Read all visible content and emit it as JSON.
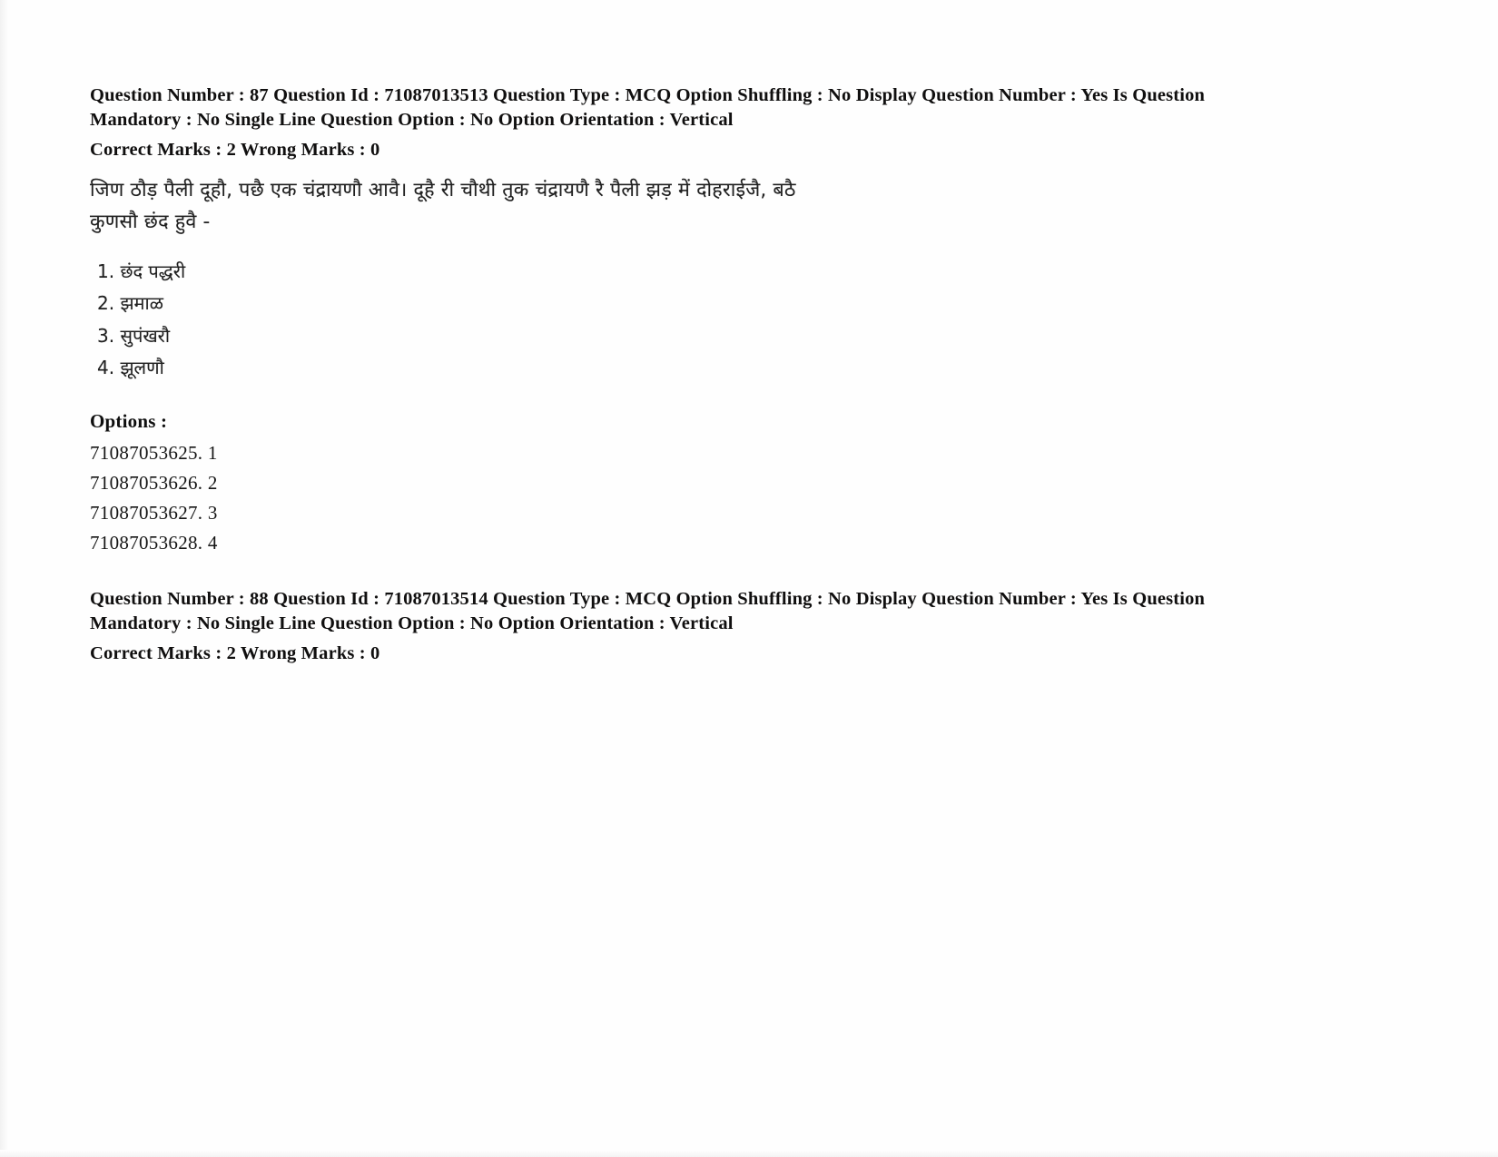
{
  "document": {
    "kind": "exam-question-dump",
    "page_background": "#ffffff",
    "text_color": "#111111"
  },
  "questions": [
    {
      "meta_line_1": "Question Number : 87 Question Id : 71087013513 Question Type : MCQ Option Shuffling : No Display Question Number : Yes Is",
      "meta_line_2": "Question Mandatory : No Single Line Question Option : No Option Orientation : Vertical",
      "marks_line": "Correct Marks : 2 Wrong Marks : 0",
      "stem_line_1": "जिण ठौड़ पैली दूहौ, पछै एक चंद्रायणौ आवै। दूहै री चौथी तुक चंद्रायणै रै पैली झड़ में दोहराईजै, बठै",
      "stem_line_2": "कुणसौ छंद हुवै -",
      "choices": [
        "1. छंद पद्धरी",
        "2. झमाळ",
        "3. सुपंखरौ",
        "4. झूलणौ"
      ],
      "options_label": "Options :",
      "option_ids": [
        "71087053625. 1",
        "71087053626. 2",
        "71087053627. 3",
        "71087053628. 4"
      ]
    },
    {
      "meta_line_1": "Question Number : 88 Question Id : 71087013514 Question Type : MCQ Option Shuffling : No Display Question Number : Yes Is",
      "meta_line_2": "Question Mandatory : No Single Line Question Option : No Option Orientation : Vertical",
      "marks_line": "Correct Marks : 2 Wrong Marks : 0"
    }
  ]
}
